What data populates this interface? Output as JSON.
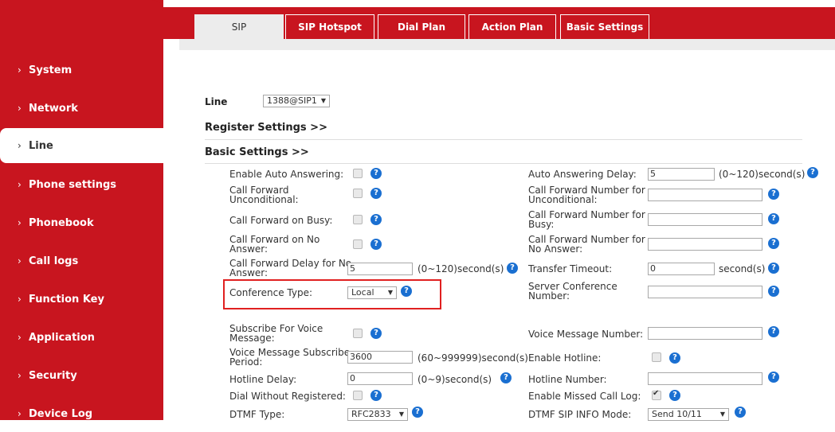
{
  "sidebar": {
    "items": [
      {
        "label": "System"
      },
      {
        "label": "Network"
      },
      {
        "label": "Line"
      },
      {
        "label": "Phone settings"
      },
      {
        "label": "Phonebook"
      },
      {
        "label": "Call logs"
      },
      {
        "label": "Function Key"
      },
      {
        "label": "Application"
      },
      {
        "label": "Security"
      },
      {
        "label": "Device Log"
      }
    ],
    "active": "Line"
  },
  "tabs": [
    {
      "label": "SIP",
      "active": true
    },
    {
      "label": "SIP Hotspot"
    },
    {
      "label": "Dial Plan"
    },
    {
      "label": "Action Plan"
    },
    {
      "label": "Basic Settings"
    }
  ],
  "line": {
    "label": "Line",
    "value": "1388@SIP1"
  },
  "sections": {
    "register": "Register Settings >>",
    "basic": "Basic Settings >>"
  },
  "left": {
    "auto_answer": "Enable Auto Answering:",
    "cf_uncond": [
      "Call Forward",
      "Unconditional:"
    ],
    "cf_busy": "Call Forward on Busy:",
    "cf_noans": [
      "Call Forward on No",
      "Answer:"
    ],
    "cf_delay": [
      "Call Forward Delay for No",
      "Answer:"
    ],
    "cf_delay_value": "5",
    "cf_delay_unit": "(0~120)second(s)",
    "conf_type": "Conference Type:",
    "conf_type_value": "Local",
    "sub_vm": [
      "Subscribe For Voice",
      "Message:"
    ],
    "vm_period": [
      "Voice Message Subscribe",
      "Period:"
    ],
    "vm_period_value": "3600",
    "vm_period_unit": "(60~999999)second(s)",
    "hotline_delay": "Hotline Delay:",
    "hotline_delay_value": "0",
    "hotline_delay_unit": "(0~9)second(s)",
    "dial_unreg": "Dial Without Registered:",
    "dtmf_type": "DTMF Type:",
    "dtmf_type_value": "RFC2833"
  },
  "right": {
    "aa_delay": "Auto Answering Delay:",
    "aa_delay_value": "5",
    "aa_delay_unit": "(0~120)second(s)",
    "cfn_uncond": [
      "Call Forward Number for",
      "Unconditional:"
    ],
    "cfn_busy": [
      "Call Forward Number for",
      "Busy:"
    ],
    "cfn_noans": [
      "Call Forward Number for",
      "No Answer:"
    ],
    "transfer_timeout": "Transfer Timeout:",
    "transfer_timeout_value": "0",
    "transfer_timeout_unit": "second(s)",
    "server_conf": [
      "Server Conference",
      "Number:"
    ],
    "vm_number": "Voice Message Number:",
    "enable_hotline": "Enable Hotline:",
    "hotline_number": "Hotline Number:",
    "missed_log": "Enable Missed Call Log:",
    "dtmf_sip_info": "DTMF SIP INFO Mode:",
    "dtmf_sip_info_value": "Send 10/11"
  },
  "help_glyph": "?",
  "colors": {
    "brand": "#c8151f",
    "help": "#1a6fd1",
    "highlight": "#e02020"
  }
}
